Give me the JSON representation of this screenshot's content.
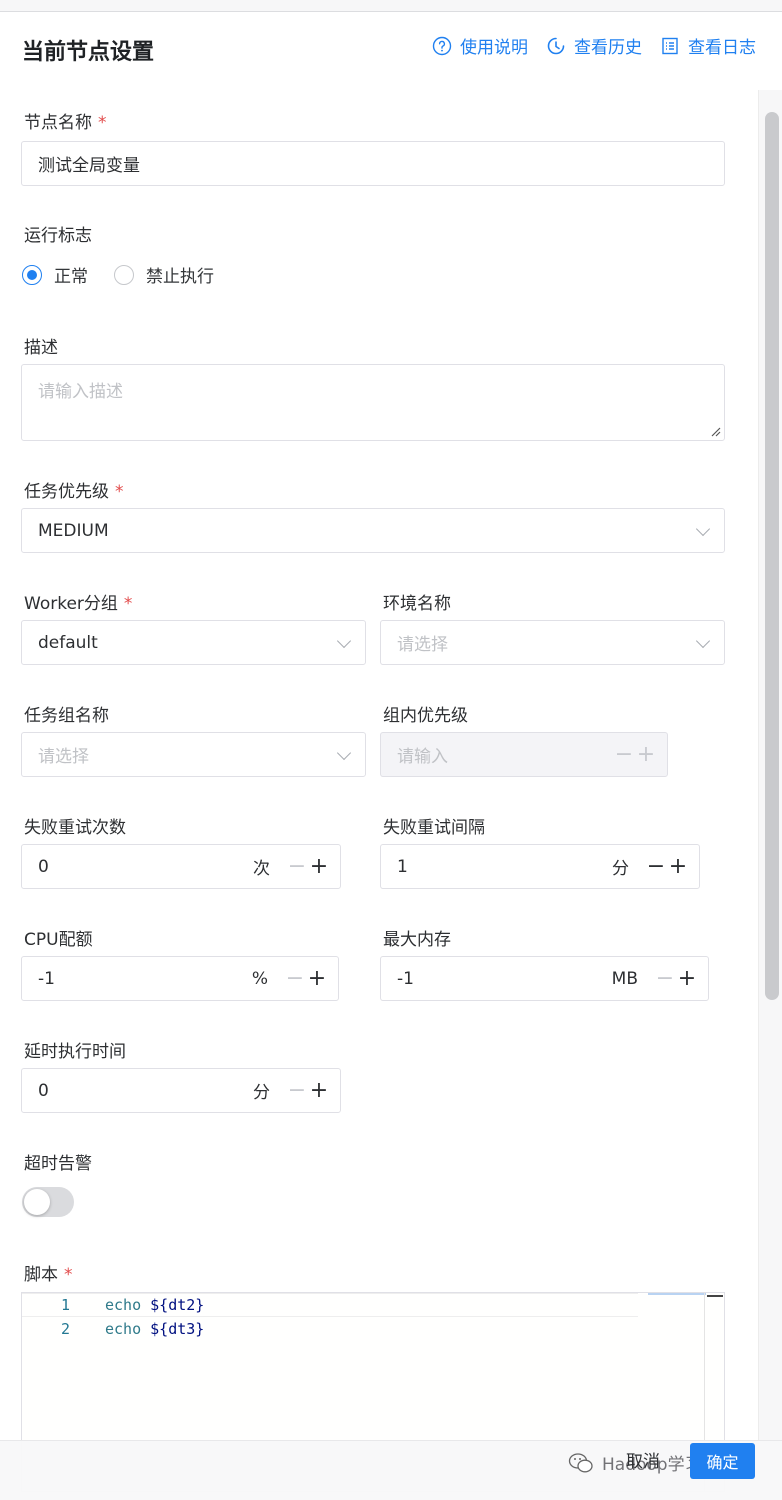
{
  "header": {
    "title": "当前节点设置",
    "actions": [
      {
        "label": "使用说明",
        "icon": "help-circle-icon"
      },
      {
        "label": "查看历史",
        "icon": "history-clock-icon"
      },
      {
        "label": "查看日志",
        "icon": "log-list-icon"
      }
    ]
  },
  "form": {
    "node_name": {
      "label": "节点名称",
      "required": "*",
      "value": "测试全局变量"
    },
    "run_flag": {
      "label": "运行标志",
      "options": [
        "正常",
        "禁止执行"
      ],
      "selected": "正常"
    },
    "description": {
      "label": "描述",
      "placeholder": "请输入描述"
    },
    "task_priority": {
      "label": "任务优先级",
      "required": "*",
      "value": "MEDIUM"
    },
    "worker_group": {
      "label": "Worker分组",
      "required": "*",
      "value": "default"
    },
    "environment": {
      "label": "环境名称",
      "placeholder": "请选择"
    },
    "task_group": {
      "label": "任务组名称",
      "placeholder": "请选择"
    },
    "group_priority": {
      "label": "组内优先级",
      "placeholder": "请输入"
    },
    "retry_times": {
      "label": "失败重试次数",
      "value": "0",
      "unit": "次"
    },
    "retry_interval": {
      "label": "失败重试间隔",
      "value": "1",
      "unit": "分"
    },
    "cpu_quota": {
      "label": "CPU配额",
      "value": "-1",
      "unit": "%"
    },
    "max_memory": {
      "label": "最大内存",
      "value": "-1",
      "unit": "MB"
    },
    "delay_time": {
      "label": "延时执行时间",
      "value": "0",
      "unit": "分"
    },
    "timeout_alarm": {
      "label": "超时告警",
      "enabled": false
    },
    "script": {
      "label": "脚本",
      "required": "*",
      "lines": [
        {
          "num": "1",
          "cmd": "echo",
          "arg": "${dt2}"
        },
        {
          "num": "2",
          "cmd": "echo",
          "arg": "${dt3}"
        }
      ]
    }
  },
  "footer": {
    "cancel": "取消",
    "confirm": "确定"
  },
  "watermark": {
    "text": "Hadoop学习之路"
  },
  "colors": {
    "accent": "#2080f0",
    "required": "#e24c4c"
  }
}
